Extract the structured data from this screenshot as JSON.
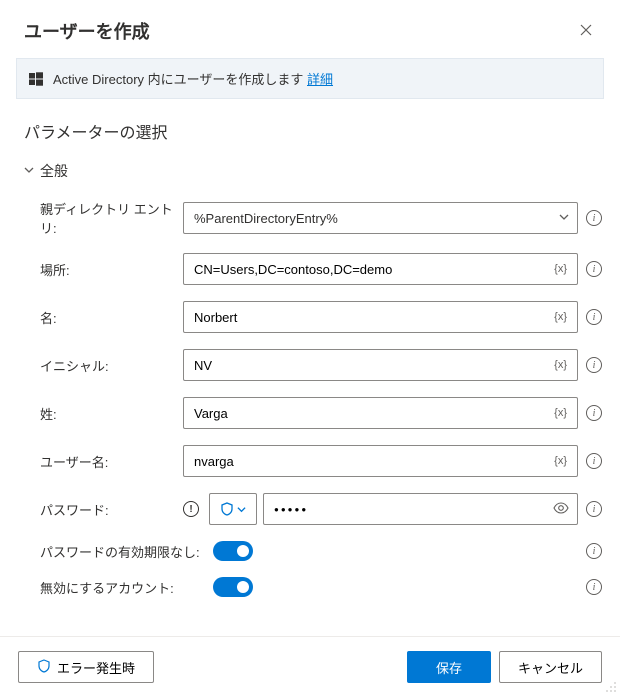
{
  "header": {
    "title": "ユーザーを作成"
  },
  "banner": {
    "text": "Active Directory 内にユーザーを作成します",
    "link": "詳細"
  },
  "section": {
    "title": "パラメーターの選択",
    "group": "全般"
  },
  "fields": {
    "parentDir": {
      "label": "親ディレクトリ エントリ:",
      "value": "%ParentDirectoryEntry%"
    },
    "location": {
      "label": "場所:",
      "value": "CN=Users,DC=contoso,DC=demo"
    },
    "firstName": {
      "label": "名:",
      "value": "Norbert"
    },
    "initials": {
      "label": "イニシャル:",
      "value": "NV"
    },
    "lastName": {
      "label": "姓:",
      "value": "Varga"
    },
    "userName": {
      "label": "ユーザー名:",
      "value": "nvarga"
    },
    "password": {
      "label": "パスワード:",
      "value": "●●●●●"
    },
    "pwdNeverExpires": {
      "label": "パスワードの有効期限なし:",
      "on": true
    },
    "disabledAccount": {
      "label": "無効にするアカウント:",
      "on": true
    }
  },
  "footer": {
    "onError": "エラー発生時",
    "save": "保存",
    "cancel": "キャンセル"
  },
  "glyphs": {
    "varBadge": "{x}"
  }
}
